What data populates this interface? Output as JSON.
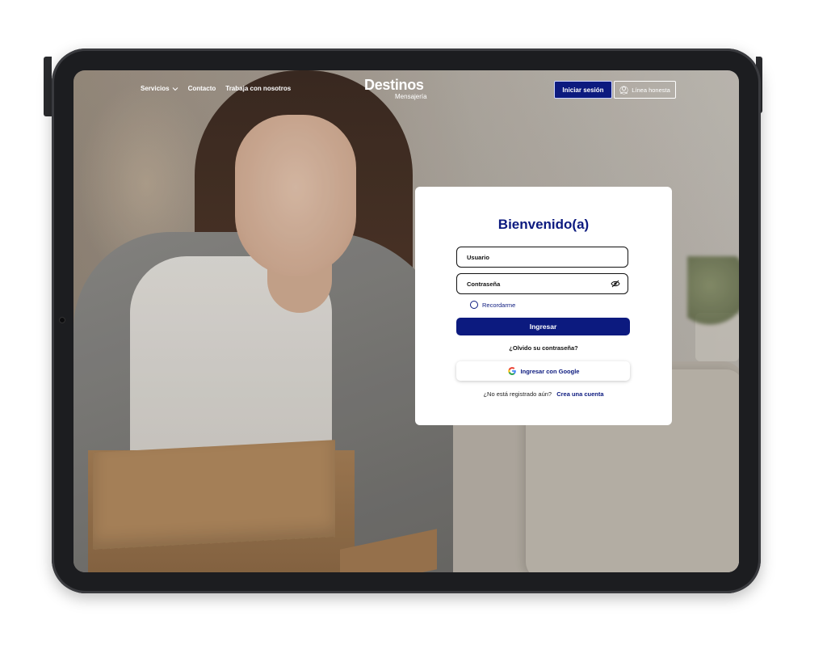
{
  "nav": {
    "links": [
      {
        "label": "Servicios"
      },
      {
        "label": "Contacto"
      },
      {
        "label": "Trabaja con nosotros"
      }
    ],
    "logo": {
      "main": "Destinos",
      "sub": "Mensajería"
    },
    "login_button": "Iniciar sesión",
    "linea_honesta_button": "Línea honesta"
  },
  "login": {
    "title": "Bienvenido(a)",
    "username_placeholder": "Usuario",
    "password_placeholder": "Contraseña",
    "remember_label": "Recordarme",
    "submit_label": "Ingresar",
    "forgot_label": "¿Olvido su contraseña?",
    "google_label": "Ingresar con Google",
    "register_prompt": "¿No está registrado aún?",
    "register_link": "Crea una cuenta"
  },
  "colors": {
    "brand": "#0c1a7f",
    "card": "#ffffff"
  },
  "icons": {
    "services_dropdown": "chevron-down-icon",
    "linea_honesta": "user-shield-icon",
    "password_toggle": "eye-off-icon",
    "google": "google-g-icon"
  }
}
